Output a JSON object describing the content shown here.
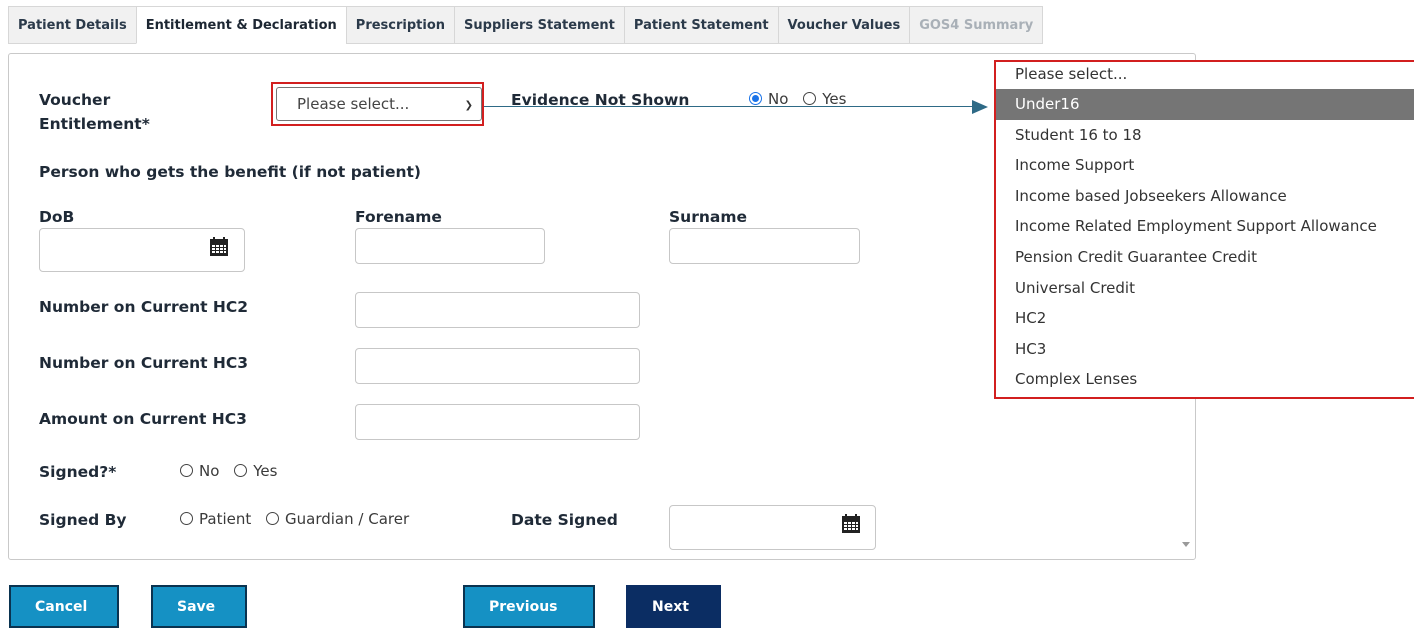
{
  "tabs": [
    {
      "label": "Patient Details"
    },
    {
      "label": "Entitlement & Declaration"
    },
    {
      "label": "Prescription"
    },
    {
      "label": "Suppliers Statement"
    },
    {
      "label": "Patient Statement"
    },
    {
      "label": "Voucher Values"
    },
    {
      "label": "GOS4 Summary"
    }
  ],
  "form": {
    "voucher_entitlement_label_line1": "Voucher",
    "voucher_entitlement_label_line2": "Entitlement*",
    "voucher_select_value": "Please select...",
    "evidence_label": "Evidence Not Shown",
    "evidence_no": "No",
    "evidence_yes": "Yes",
    "benefit_heading": "Person who gets the benefit (if not patient)",
    "dob_label": "DoB",
    "forename_label": "Forename",
    "surname_label": "Surname",
    "hc2_number_label": "Number on Current HC2",
    "hc3_number_label": "Number on Current HC3",
    "hc3_amount_label": "Amount on Current HC3",
    "signed_label": "Signed?*",
    "signed_no": "No",
    "signed_yes": "Yes",
    "signed_by_label": "Signed By",
    "signed_by_patient": "Patient",
    "signed_by_guardian": "Guardian / Carer",
    "date_signed_label": "Date Signed"
  },
  "dropdown": {
    "options": [
      "Please select...",
      "Under16",
      "Student 16 to 18",
      "Income Support",
      "Income based Jobseekers Allowance",
      "Income Related Employment Support Allowance",
      "Pension Credit Guarantee Credit",
      "Universal Credit",
      "HC2",
      "HC3",
      "Complex Lenses"
    ],
    "highlighted": "Under16"
  },
  "buttons": {
    "cancel": "Cancel",
    "save": "Save",
    "previous": "Previous",
    "next": "Next"
  },
  "colors": {
    "primary_button": "#1591c4",
    "dark_button": "#0b2d63",
    "highlight_border": "#d21f1f",
    "connector": "#2e6a86"
  }
}
